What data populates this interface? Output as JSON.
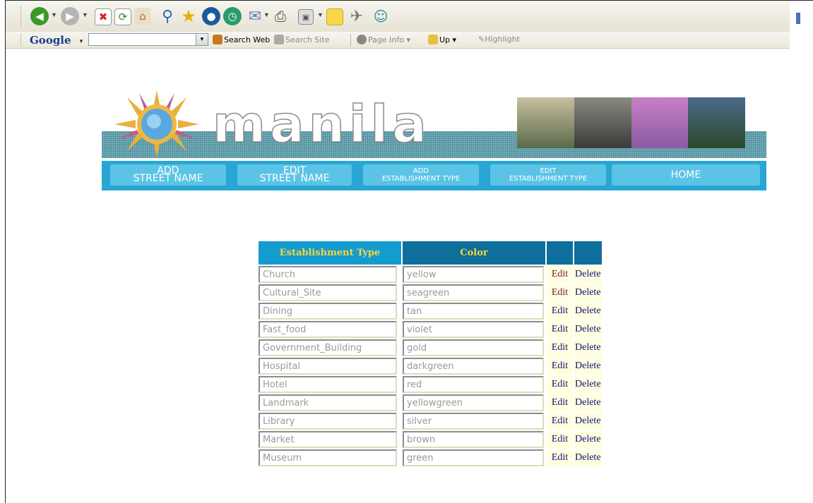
{
  "toolbar": {
    "icons": [
      "back-icon",
      "forward-icon",
      "stop-icon",
      "refresh-icon",
      "home-icon",
      "search-icon",
      "favorites-icon",
      "media-icon",
      "history-icon",
      "mail-icon",
      "print-icon",
      "edit-icon",
      "notes-icon",
      "messenger-icon",
      "contacts-icon"
    ]
  },
  "google_bar": {
    "brand": "Google",
    "search_value": "",
    "items": {
      "search_web": "Search Web",
      "search_site": "Search Site",
      "page_info": "Page Info",
      "up": "Up",
      "highlight": "Highlight"
    }
  },
  "nav": {
    "add_street_line1": "ADD",
    "add_street_line2": "STREET NAME",
    "edit_street_line1": "EDIT",
    "edit_street_line2": "STREET NAME",
    "add_type_line1": "ADD",
    "add_type_line2": "ESTABLISHMENT TYPE",
    "edit_type_line1": "EDIT",
    "edit_type_line2": "ESTABLISHMENT TYPE",
    "home": "HOME"
  },
  "table": {
    "header_type": "Establishment Type",
    "header_color": "Color",
    "rows": [
      {
        "type": "Church",
        "color": "yellow",
        "edit": "Edit",
        "delete": "Delete"
      },
      {
        "type": "Cultural_Site",
        "color": "seagreen",
        "edit": "Edit",
        "delete": "Delete"
      },
      {
        "type": "Dining",
        "color": "tan",
        "edit": "Edit",
        "delete": "Delete"
      },
      {
        "type": "Fast_food",
        "color": "violet",
        "edit": "Edit",
        "delete": "Delete"
      },
      {
        "type": "Government_Building",
        "color": "gold",
        "edit": "Edit",
        "delete": "Delete"
      },
      {
        "type": "Hospital",
        "color": "darkgreen",
        "edit": "Edit",
        "delete": "Delete"
      },
      {
        "type": "Hotel",
        "color": "red",
        "edit": "Edit",
        "delete": "Delete"
      },
      {
        "type": "Landmark",
        "color": "yellowgreen",
        "edit": "Edit",
        "delete": "Delete"
      },
      {
        "type": "Library",
        "color": "silver",
        "edit": "Edit",
        "delete": "Delete"
      },
      {
        "type": "Market",
        "color": "brown",
        "edit": "Edit",
        "delete": "Delete"
      },
      {
        "type": "Museum",
        "color": "green",
        "edit": "Edit",
        "delete": "Delete"
      }
    ]
  }
}
